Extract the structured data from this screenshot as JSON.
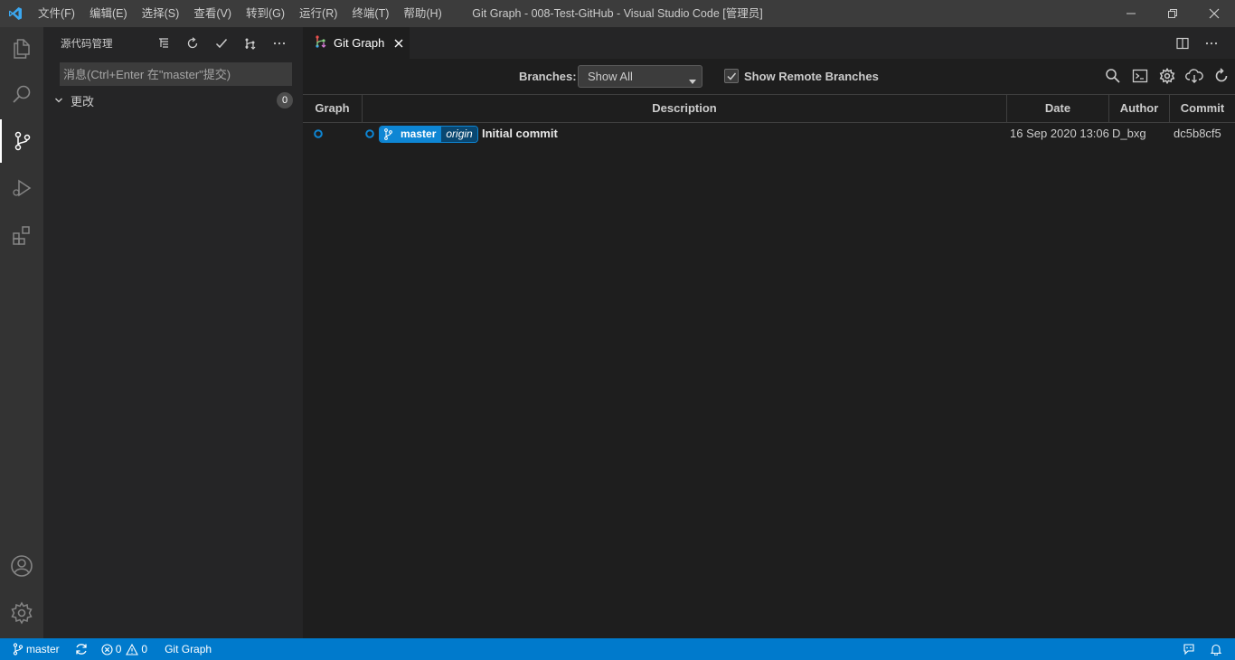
{
  "window": {
    "title": "Git Graph - 008-Test-GitHub - Visual Studio Code [管理员]",
    "menu": [
      "文件(F)",
      "编辑(E)",
      "选择(S)",
      "查看(V)",
      "转到(G)",
      "运行(R)",
      "终端(T)",
      "帮助(H)"
    ]
  },
  "activity_bar": {
    "items": [
      "explorer-icon",
      "search-icon",
      "source-control-icon",
      "run-debug-icon",
      "extensions-icon"
    ],
    "bottom": [
      "accounts-icon",
      "manage-gear-icon"
    ],
    "active": "source-control-icon"
  },
  "sidebar": {
    "title": "源代码管理",
    "message_placeholder": "消息(Ctrl+Enter 在\"master\"提交)",
    "changes_label": "更改",
    "changes_count": "0"
  },
  "tabs": [
    {
      "label": "Git Graph",
      "icon": "git-graph-icon",
      "active": true
    }
  ],
  "git_graph": {
    "branches_label": "Branches:",
    "branches_value": "Show All",
    "show_remote_label": "Show Remote Branches",
    "show_remote_checked": true,
    "columns": [
      "Graph",
      "Description",
      "Date",
      "Author",
      "Commit"
    ],
    "commits": [
      {
        "branch": "master",
        "remote": "origin",
        "description": "Initial commit",
        "date": "16 Sep 2020 13:06",
        "author": "D_bxg",
        "commit": "dc5b8cf5"
      }
    ]
  },
  "statusbar": {
    "branch": "master",
    "errors": "0",
    "warnings": "0",
    "git_graph": "Git Graph"
  },
  "colors": {
    "accent": "#007acc",
    "graph_node": "#0e86d4",
    "titlebar": "#3c3c3c",
    "activitybar": "#333333",
    "sidebar": "#252526",
    "editor": "#1e1e1e"
  }
}
